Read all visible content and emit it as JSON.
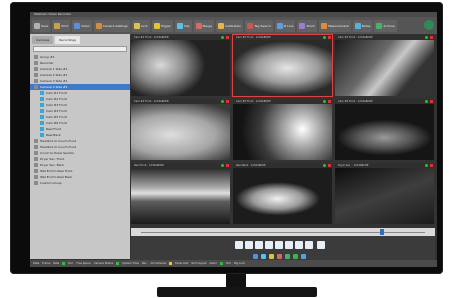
{
  "window": {
    "title": "WebCam Video Recorder"
  },
  "toolbar": {
    "buttons": [
      {
        "label": "Save",
        "color": "#b0b0b0"
      },
      {
        "label": "Print",
        "color": "#c9a14c"
      },
      {
        "label": "Video",
        "color": "#5b8ed6"
      },
      {
        "label": "Camera Settings",
        "color": "#d38b3c"
      },
      {
        "label": "Lock",
        "color": "#d6c24c"
      },
      {
        "label": "Trigger",
        "color": "#e2c238"
      },
      {
        "label": "Clip",
        "color": "#58c2e8"
      },
      {
        "label": "Merge",
        "color": "#d86868"
      },
      {
        "label": "Calibration",
        "color": "#e6b646"
      },
      {
        "label": "Tag Search",
        "color": "#cc5555"
      },
      {
        "label": "Pi Line",
        "color": "#5aa0dd"
      },
      {
        "label": "Zoom",
        "color": "#9b7ad6"
      },
      {
        "label": "Measurement",
        "color": "#e08a3a"
      },
      {
        "label": "Notes",
        "color": "#55b3d6"
      },
      {
        "label": "Archive",
        "color": "#49b06a"
      }
    ]
  },
  "sidebar": {
    "tabs": [
      "Cameras",
      "Recordings"
    ],
    "items": [
      {
        "label": "Group #1",
        "sel": false
      },
      {
        "label": "Recorder",
        "sel": false
      },
      {
        "label": "Camera 1 Side #1",
        "sel": false
      },
      {
        "label": "Camera 2 Side #1",
        "sel": false
      },
      {
        "label": "Camera 3 Side #1",
        "sel": false
      },
      {
        "label": "Camera 4 Side #1",
        "sel": true
      },
      {
        "label": "Cam #1 Front",
        "sel": false
      },
      {
        "label": "Cam #2 Front",
        "sel": false
      },
      {
        "label": "Cam #3 Front",
        "sel": false
      },
      {
        "label": "Cam #4 Front",
        "sel": false
      },
      {
        "label": "Cam #5 Front",
        "sel": false
      },
      {
        "label": "Cam #6 Front",
        "sel": false
      },
      {
        "label": "Reel Front",
        "sel": false
      },
      {
        "label": "Reel Back",
        "sel": false
      },
      {
        "label": "Headbox to Couch Front",
        "sel": false
      },
      {
        "label": "Headbox to Couch Front",
        "sel": false
      },
      {
        "label": "Couch to Press Section",
        "sel": false
      },
      {
        "label": "Dryer Sec. Front",
        "sel": false
      },
      {
        "label": "Dryer Sec. Back",
        "sel": false
      },
      {
        "label": "Wet End to Reel Front",
        "sel": false
      },
      {
        "label": "Wet End to Reel Back",
        "sel": false
      },
      {
        "label": "Custom Group",
        "sel": false
      }
    ]
  },
  "cameras": [
    {
      "name": "Cam #1 Front · 1234ABCDE",
      "selected": false,
      "style": "rollL"
    },
    {
      "name": "Cam #2 Front · 1234ABCDE",
      "selected": true,
      "style": "drum"
    },
    {
      "name": "Cam #3 Front · 1234ABCDE",
      "selected": false,
      "style": "diag"
    },
    {
      "name": "Cam #4 Front · 1234ABCDE",
      "selected": false,
      "style": "bright"
    },
    {
      "name": "Cam #5 Front · 1234ABCDE",
      "selected": false,
      "style": "flare"
    },
    {
      "name": "Cam #6 Front · 1234ABCDE",
      "selected": false,
      "style": "roll"
    },
    {
      "name": "Reel Front · 1234ABCDE",
      "selected": false,
      "style": "stripe"
    },
    {
      "name": "Reel Back · 1234ABCDE",
      "selected": false,
      "style": "cyl"
    },
    {
      "name": "Dryer Sec. · 1234ABCDE",
      "selected": false,
      "style": "dark"
    }
  ],
  "timeline": {
    "position": 0.85
  },
  "status": {
    "items": [
      "Date",
      "Frame",
      "Rate",
      "Dur.",
      "Free Space",
      "Camera Status",
      "System Time",
      "Rec.",
      "All Cameras",
      "Show Grid",
      "Grid Layout",
      "Alarm",
      "PLC",
      "Tag Lock"
    ],
    "dot_colors": [
      "#3bb34a",
      "#3bb34a",
      "#e6c53a",
      "#3bb34a",
      "#d33"
    ]
  }
}
